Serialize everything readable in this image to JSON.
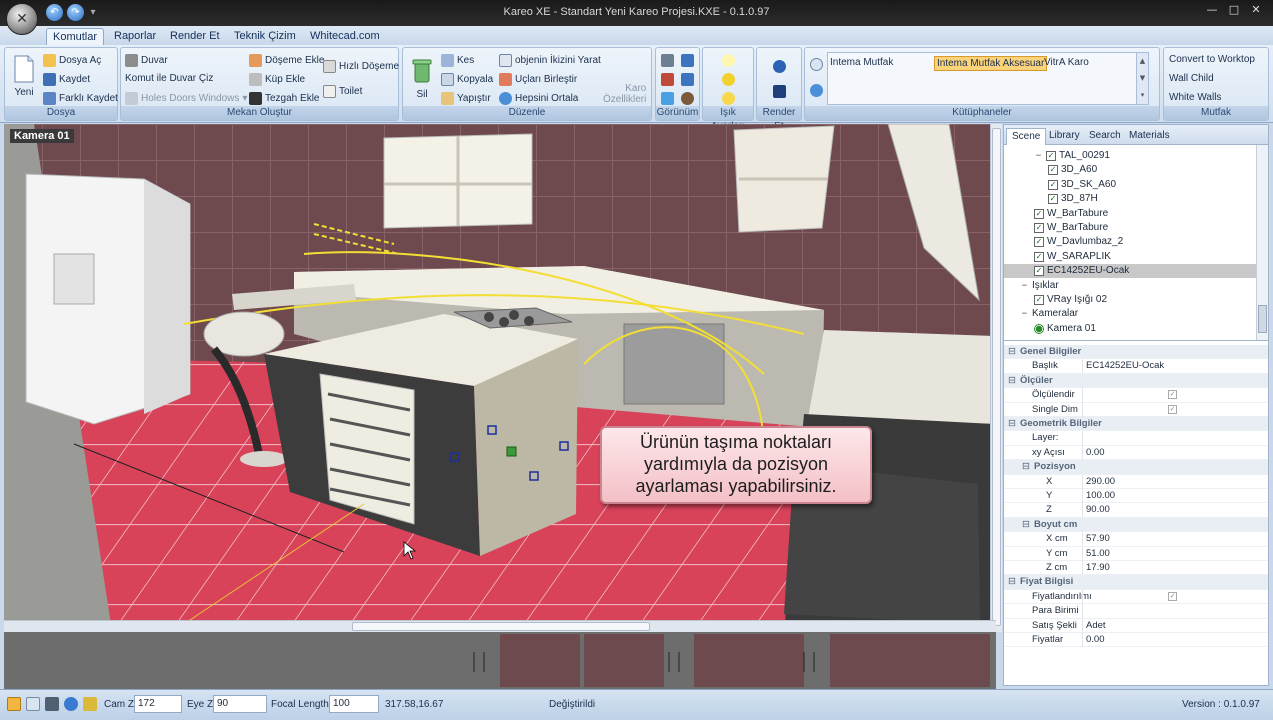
{
  "window": {
    "title": "Kareo XE - Standart Yeni Kareo Projesi.KXE - 0.1.0.97",
    "buttons": [
      "minimize",
      "maximize",
      "close"
    ],
    "app_icon": "kareo-logo-icon",
    "quick_access": [
      "undo-icon",
      "redo-icon",
      "dropdown-icon"
    ]
  },
  "tabs": [
    "Komutlar",
    "Raporlar",
    "Render Et",
    "Teknik Çizim",
    "Whitecad.com"
  ],
  "ribbon": {
    "dosya": {
      "title": "Dosya",
      "yeni": "Yeni",
      "dosya_ac": "Dosya Aç",
      "kaydet": "Kaydet",
      "farkli_kaydet": "Farklı Kaydet"
    },
    "mekan": {
      "title": "Mekan Oluştur",
      "duvar": "Duvar",
      "komut_duvar": "Komut ile Duvar Çiz",
      "holes": "Holes Doors Windows",
      "doseme": "Döşeme Ekle",
      "kup": "Küp Ekle",
      "tezgah": "Tezgah Ekle",
      "hizli": "Hızlı Döşeme",
      "toilet": "Toilet"
    },
    "duzenle": {
      "title": "Düzenle",
      "sil": "Sil",
      "kes": "Kes",
      "kopyala": "Kopyala",
      "yapistir": "Yapıştır",
      "ikiz": "objenin İkizini Yarat",
      "uclar": "Uçları Birleştir",
      "ortala": "Hepsini Ortala",
      "karo1": "Karo",
      "karo2": "Özellikleri"
    },
    "gorunum": {
      "title": "Görünüm"
    },
    "isik": {
      "title": "Işık Ayarları"
    },
    "render": {
      "title": "Render Et"
    },
    "kutuphane": {
      "title": "Kütüphaneler",
      "items": [
        "Intema Mutfak",
        "Intema Mutfak Aksesuar",
        "VitrA Karo"
      ],
      "selected": "Intema Mutfak Aksesuar"
    },
    "mutfak": {
      "title": "Mutfak",
      "convert": "Convert to Worktop",
      "wall_child": "Wall Child",
      "white_walls": "White Walls"
    }
  },
  "viewport": {
    "camera_label": "Kamera 01",
    "callout": [
      "Ürünün taşıma noktaları",
      "yardımıyla da pozisyon",
      "ayarlaması yapabilirsiniz."
    ],
    "handles": 5
  },
  "scene_tabs": [
    "Scene",
    "Library",
    "Search",
    "Materials"
  ],
  "tree": [
    {
      "label": "TAL_00291",
      "level": 1,
      "expand": "−",
      "check": true
    },
    {
      "label": "3D_A60",
      "level": 2,
      "check": true
    },
    {
      "label": "3D_SK_A60",
      "level": 2,
      "check": true
    },
    {
      "label": "3D_87H",
      "level": 2,
      "check": true
    },
    {
      "label": "W_BarTabure",
      "level": 1,
      "check": true
    },
    {
      "label": "W_BarTabure",
      "level": 1,
      "check": true
    },
    {
      "label": "W_Davlumbaz_2",
      "level": 1,
      "check": true
    },
    {
      "label": "W_SARAPLIK",
      "level": 1,
      "check": true
    },
    {
      "label": "EC14252EU-Ocak",
      "level": 1,
      "check": true,
      "selected": true
    },
    {
      "label": "Işıklar",
      "level": 0,
      "expand": "−"
    },
    {
      "label": "VRay Işığı 02",
      "level": 1,
      "check": true
    },
    {
      "label": "Kameralar",
      "level": 0,
      "expand": "−"
    },
    {
      "label": "Kamera 01",
      "level": 1,
      "radio": true
    }
  ],
  "properties": [
    {
      "cat": "Genel Bilgiler"
    },
    {
      "key": "Başlık",
      "value": "EC14252EU-Ocak"
    },
    {
      "cat": "Ölçüler"
    },
    {
      "key": "Ölçülendir",
      "check": true
    },
    {
      "key": "Single Dim",
      "check": true
    },
    {
      "cat": "Geometrik Bilgiler"
    },
    {
      "key": "Layer:",
      "value": ""
    },
    {
      "key": "xy Açısı",
      "value": "0.00"
    },
    {
      "cat": "Pozisyon",
      "sub": true
    },
    {
      "key": "X",
      "value": "290.00",
      "sub": true
    },
    {
      "key": "Y",
      "value": "100.00",
      "sub": true
    },
    {
      "key": "Z",
      "value": "90.00",
      "sub": true
    },
    {
      "cat": "Boyut cm",
      "sub": true
    },
    {
      "key": "X cm",
      "value": "57.90",
      "sub": true
    },
    {
      "key": "Y cm",
      "value": "51.00",
      "sub": true
    },
    {
      "key": "Z cm",
      "value": "17.90",
      "sub": true
    },
    {
      "cat": "Fiyat Bilgisi"
    },
    {
      "key": "Fiyatlandırılmı",
      "check": true
    },
    {
      "key": "Para Birimi",
      "value": ""
    },
    {
      "key": "Satış Şekli",
      "value": "Adet"
    },
    {
      "key": "Fiyatlar",
      "value": "0.00"
    }
  ],
  "status": {
    "cam_z_label": "Cam Z",
    "cam_z": "172",
    "eye_z_label": "Eye Z",
    "eye_z": "90",
    "focal_label": "Focal Length",
    "focal": "100",
    "coords": "317.58,16.67",
    "message": "Değiştirildi",
    "version": "Version : 0.1.0.97"
  }
}
